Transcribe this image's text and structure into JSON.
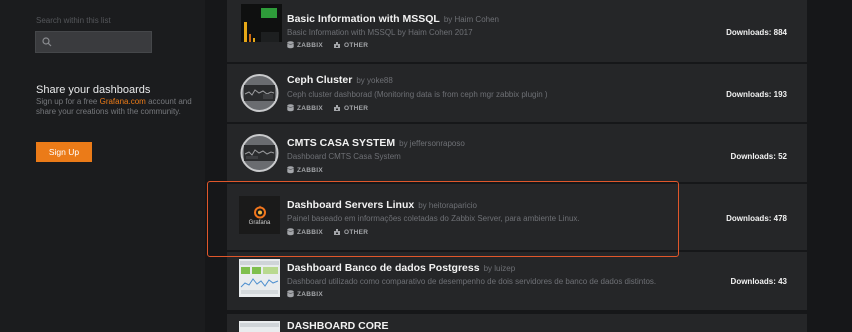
{
  "sidebar": {
    "search_label": "Search within this list",
    "share_title": "Share your dashboards",
    "share_text_1": "Sign up for a free ",
    "share_link": "Grafana.com",
    "share_text_2": "account and share your creations with the community.",
    "signup_label": "Sign Up"
  },
  "accent_color": "#eb7b18",
  "highlight_color": "#e0572b",
  "rows": [
    {
      "title": "Basic Information with MSSQL",
      "author": "by Haim Cohen",
      "description": "Basic Information with MSSQL by Haim Cohen 2017",
      "tags": [
        "ZABBIX",
        "OTHER"
      ],
      "downloads": "Downloads: 884",
      "thumb_icon": "dashboard-thumbnail-icon"
    },
    {
      "title": "Ceph Cluster",
      "author": "by yoke88",
      "description": "Ceph cluster dashborad (Monitoring data is from ceph mgr zabbix plugin )",
      "tags": [
        "ZABBIX",
        "OTHER"
      ],
      "downloads": "Downloads: 193",
      "thumb_icon": "circle-dashboard-thumbnail-icon"
    },
    {
      "title": "CMTS CASA SYSTEM",
      "author": "by jeffersonraposo",
      "description": "Dashboard CMTS Casa System",
      "tags": [
        "ZABBIX"
      ],
      "downloads": "Downloads: 52",
      "thumb_icon": "circle-dashboard-thumbnail-icon"
    },
    {
      "title": "Dashboard Servers Linux",
      "author": "by heitoraparicio",
      "description": "Painel baseado em informações coletadas do Zabbix Server, para ambiente Linux.",
      "tags": [
        "ZABBIX",
        "OTHER"
      ],
      "downloads": "Downloads: 478",
      "thumb_icon": "grafana-logo-icon",
      "thumb_text": "Grafana"
    },
    {
      "title": "Dashboard Banco de dados Postgress",
      "author": "by luizep",
      "description": "Dashboard utilizado como comparativo de desempenho de dois servidores de banco de dados distintos.",
      "tags": [
        "ZABBIX"
      ],
      "downloads": "Downloads: 43",
      "thumb_icon": "dashboard-thumbnail-icon"
    },
    {
      "title": "DASHBOARD CORE",
      "thumb_icon": "dashboard-thumbnail-icon"
    }
  ]
}
